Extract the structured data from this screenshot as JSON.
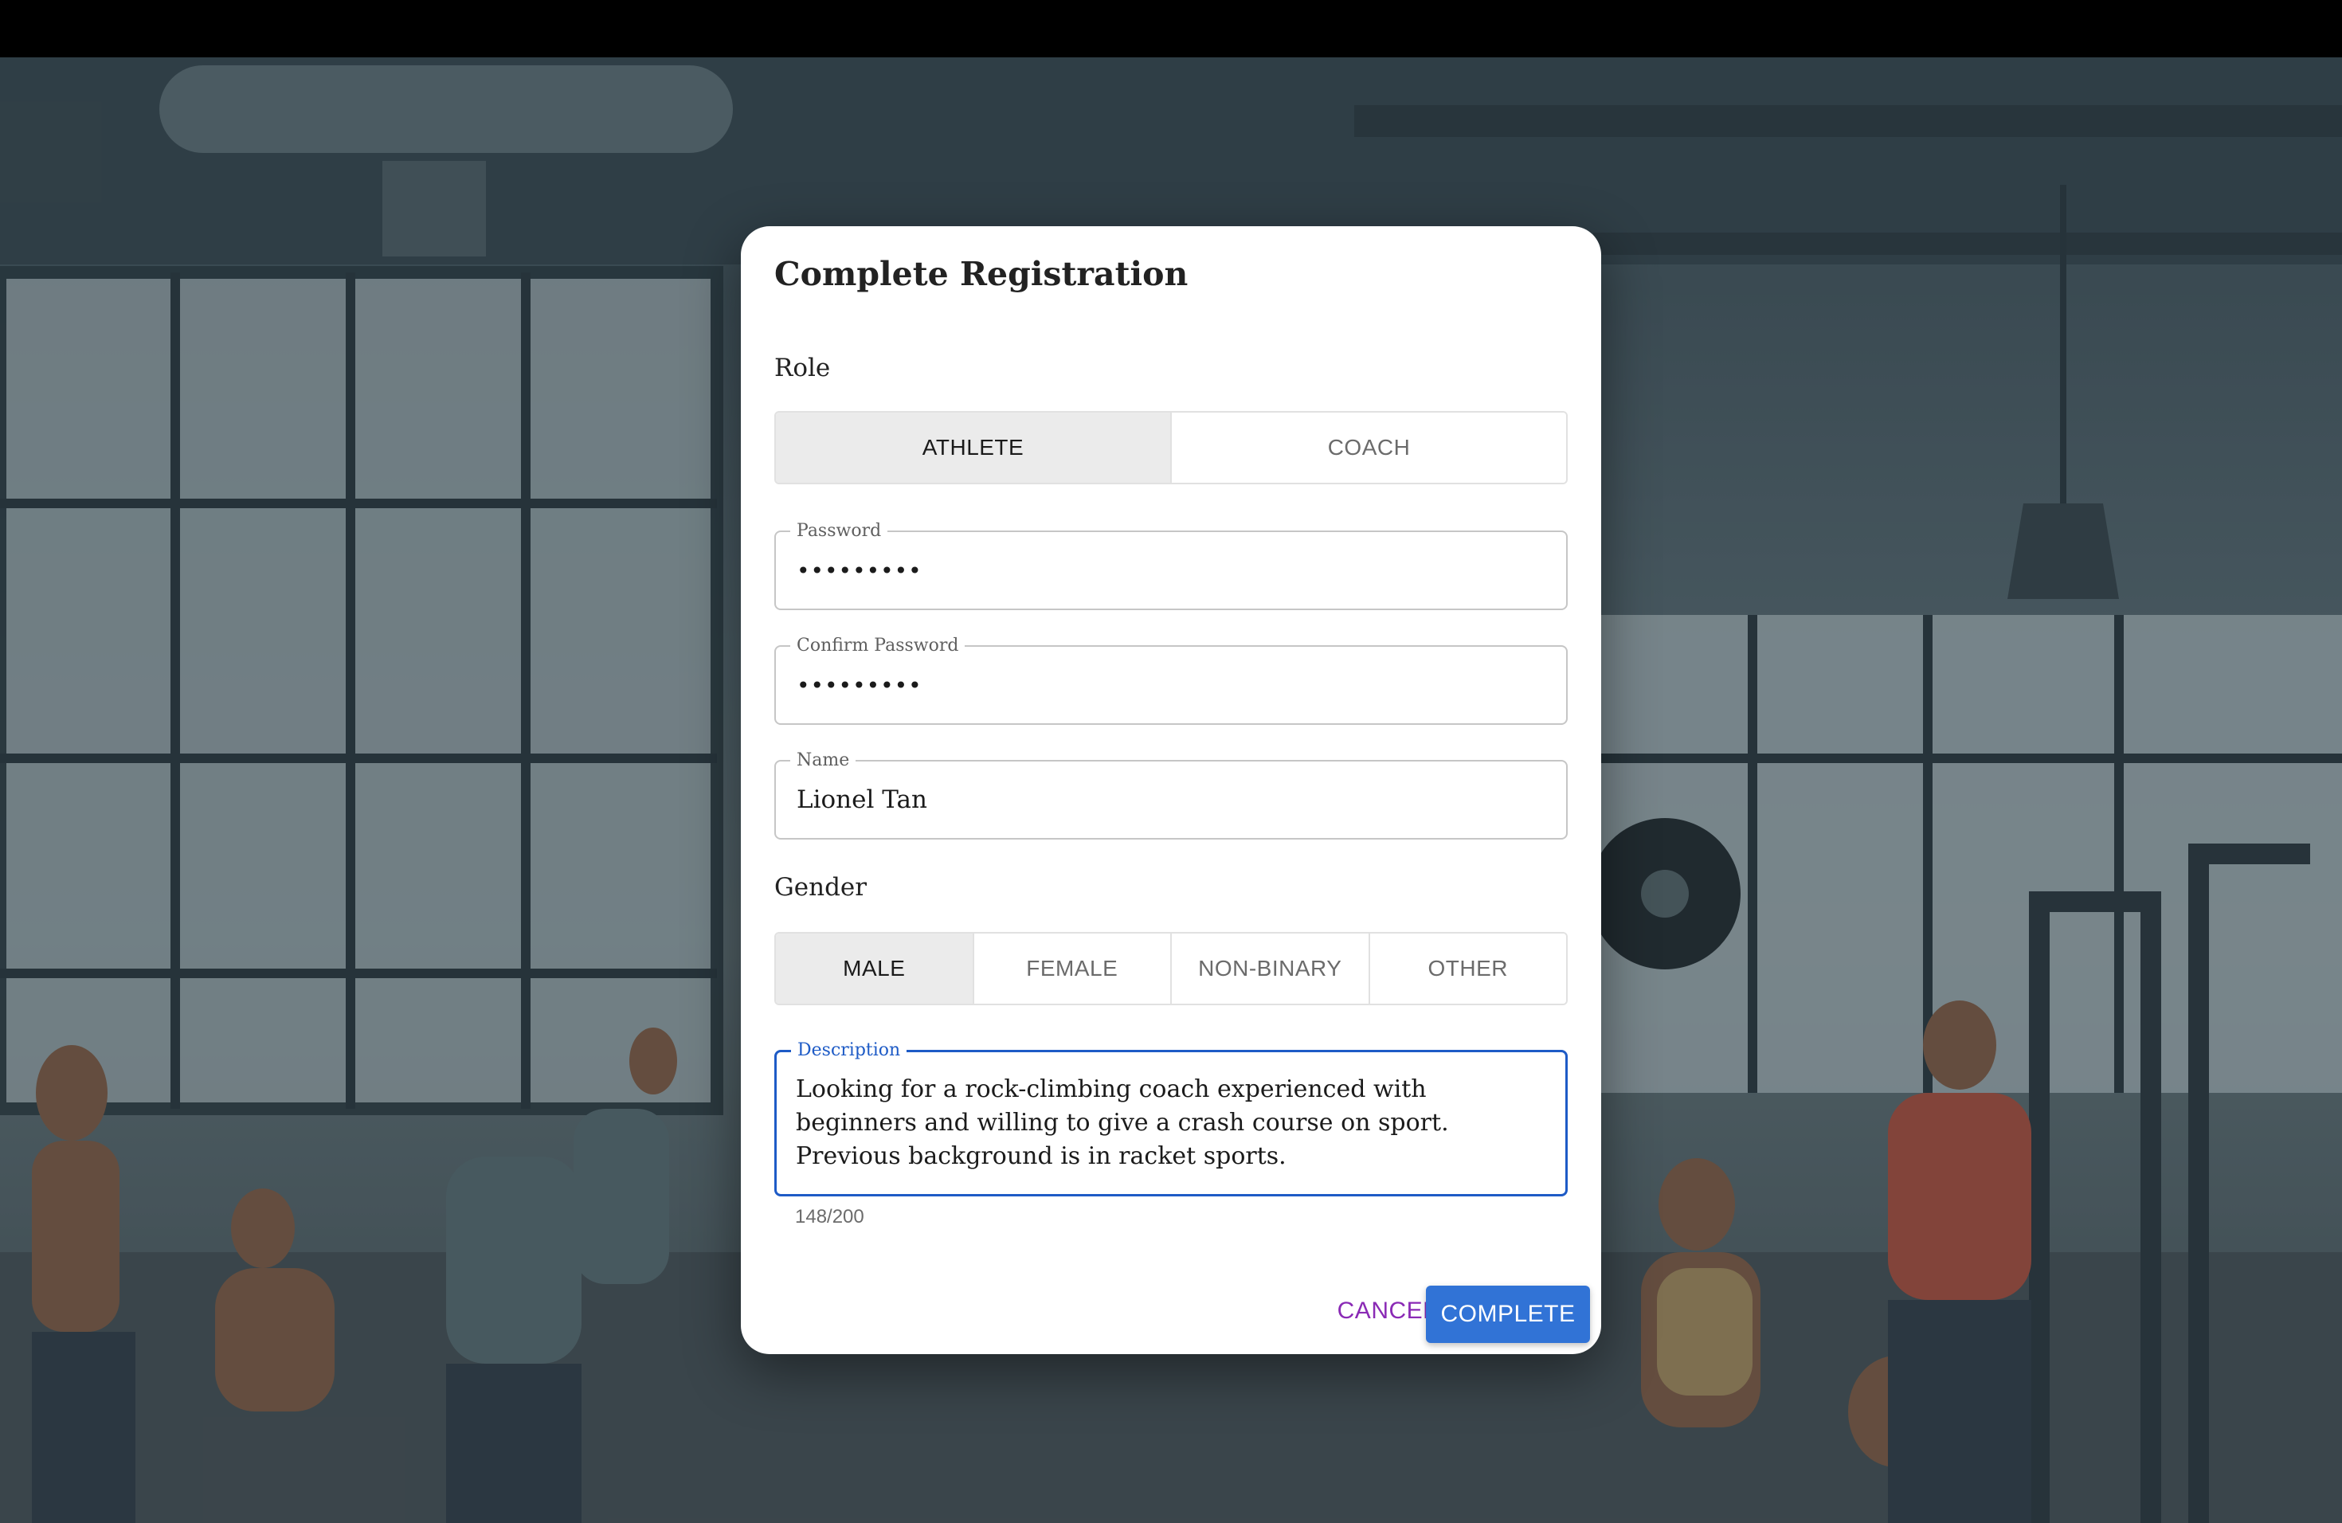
{
  "dialog": {
    "title": "Complete Registration",
    "role": {
      "label": "Role",
      "options": [
        "ATHLETE",
        "COACH"
      ],
      "selected": "ATHLETE"
    },
    "password": {
      "label": "Password",
      "value": "•••••••••"
    },
    "confirm_password": {
      "label": "Confirm Password",
      "value": "•••••••••"
    },
    "name": {
      "label": "Name",
      "value": "Lionel Tan"
    },
    "gender": {
      "label": "Gender",
      "options": [
        "MALE",
        "FEMALE",
        "NON-BINARY",
        "OTHER"
      ],
      "selected": "MALE"
    },
    "description": {
      "label": "Description",
      "value": "Looking for a rock-climbing coach experienced with beginners and willing to give a crash course on sport.  Previous background is in racket sports.",
      "counter": "148/200"
    },
    "actions": {
      "cancel": "CANCEL",
      "complete": "COMPLETE"
    }
  },
  "colors": {
    "accent": "#1e5bc6",
    "primary_button": "#3173d6",
    "cancel_text": "#8a2ab5",
    "selected_toggle": "#ebebeb"
  }
}
